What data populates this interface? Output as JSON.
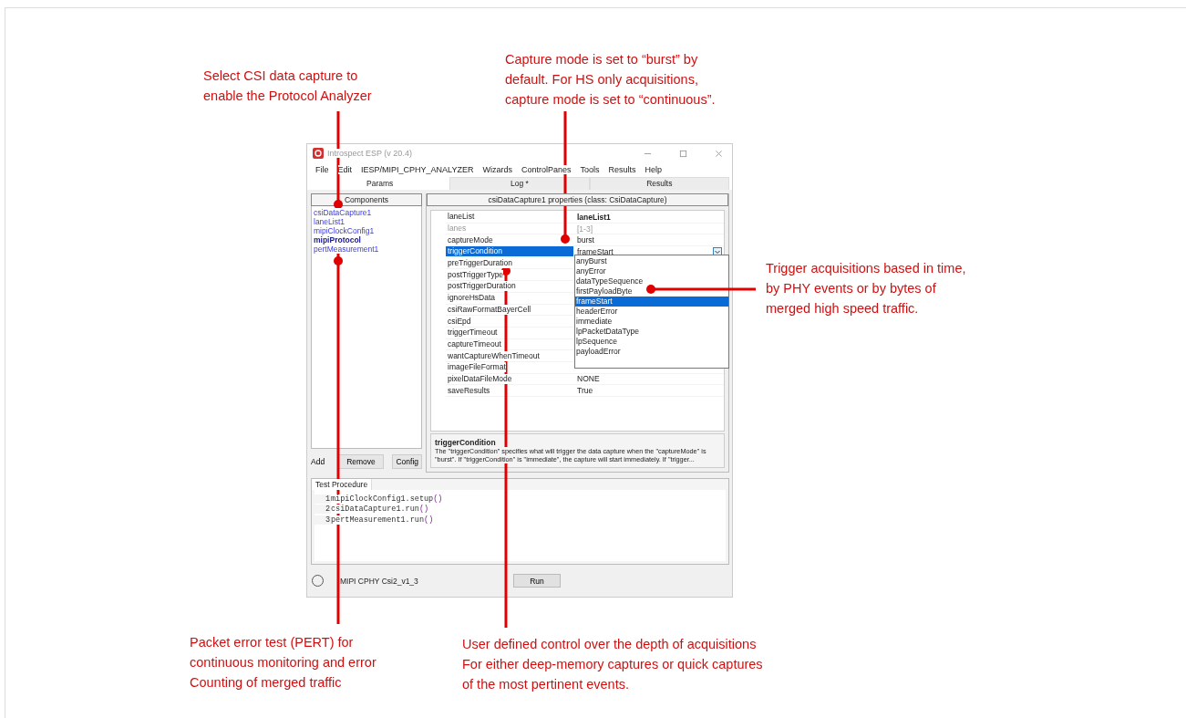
{
  "annotations": [
    {
      "kind": "top-left",
      "lines": [
        "Select CSI data capture to",
        "enable the Protocol Analyzer"
      ]
    },
    {
      "kind": "top-center",
      "lines": [
        "Capture mode is set to “burst” by",
        "default.  For HS only acquisitions,",
        "capture mode is set to “continuous”."
      ]
    },
    {
      "kind": "right",
      "lines": [
        "Trigger acquisitions based in time,",
        "by PHY events or by bytes of",
        "merged high speed traffic."
      ]
    },
    {
      "kind": "bottom-left",
      "lines": [
        "Packet error test (PERT) for",
        "continuous monitoring and error",
        "Counting of merged traffic"
      ]
    },
    {
      "kind": "bottom-center",
      "lines": [
        "User defined control over the depth of acquisitions",
        "For either deep-memory captures or quick captures",
        "of the most pertinent events."
      ]
    }
  ],
  "window": {
    "title": "Introspect ESP (v 20.4)",
    "menu": [
      "File",
      "Edit",
      "IESP/MIPI_CPHY_ANALYZER",
      "Wizards",
      "ControlPanes",
      "Tools",
      "Results",
      "Help"
    ],
    "tabs": [
      {
        "label": "Params",
        "selected": true
      },
      {
        "label": "Log *",
        "selected": false
      },
      {
        "label": "Results",
        "selected": false
      }
    ],
    "components": {
      "header": "Components",
      "items": [
        {
          "label": "csiDataCapture1",
          "bold": false
        },
        {
          "label": "laneList1",
          "bold": false
        },
        {
          "label": "mipiClockConfig1",
          "bold": false
        },
        {
          "label": "mipiProtocol",
          "bold": true
        },
        {
          "label": "pertMeasurement1",
          "bold": false
        }
      ],
      "buttons": [
        "Add",
        "Remove",
        "Config"
      ]
    },
    "properties": {
      "header": "csiDataCapture1 properties (class: CsiDataCapture)",
      "rows": [
        {
          "name": "laneList",
          "value": "laneList1",
          "bold": true,
          "disabled": false,
          "selected": false
        },
        {
          "name": "lanes",
          "value": "[1-3]",
          "bold": false,
          "disabled": true,
          "selected": false
        },
        {
          "name": "captureMode",
          "value": "burst",
          "bold": false,
          "disabled": false,
          "selected": false
        },
        {
          "name": "triggerCondition",
          "value": "frameStart",
          "disabled": false,
          "selected": true
        },
        {
          "name": "preTriggerDuration",
          "disabled": false,
          "selected": false
        },
        {
          "name": "postTriggerType",
          "disabled": false,
          "selected": false
        },
        {
          "name": "postTriggerDuration",
          "disabled": false,
          "selected": false
        },
        {
          "name": "ignoreHsData",
          "disabled": false,
          "selected": false
        },
        {
          "name": "csiRawFormatBayerCell",
          "disabled": false,
          "selected": false
        },
        {
          "name": "csiEpd",
          "disabled": false,
          "selected": false
        },
        {
          "name": "triggerTimeout",
          "disabled": false,
          "selected": false
        },
        {
          "name": "captureTimeout",
          "disabled": false,
          "selected": false
        },
        {
          "name": "wantCaptureWhenTimeout",
          "disabled": false,
          "selected": false
        },
        {
          "name": "imageFileFormat",
          "disabled": false,
          "selected": false
        },
        {
          "name": "pixelDataFileMode",
          "value": "NONE",
          "bold": false,
          "disabled": false,
          "selected": false
        },
        {
          "name": "saveResults",
          "value": "True",
          "bold": false,
          "disabled": false,
          "selected": false
        }
      ],
      "dropdown": [
        {
          "label": "anyBurst",
          "selected": false
        },
        {
          "label": "anyError",
          "selected": false
        },
        {
          "label": "dataTypeSequence",
          "selected": false
        },
        {
          "label": "firstPayloadByte",
          "selected": false
        },
        {
          "label": "frameStart",
          "selected": true
        },
        {
          "label": "headerError",
          "selected": false
        },
        {
          "label": "immediate",
          "selected": false
        },
        {
          "label": "lpPacketDataType",
          "selected": false
        },
        {
          "label": "lpSequence",
          "selected": false
        },
        {
          "label": "payloadError",
          "selected": false
        }
      ],
      "description": {
        "title": "triggerCondition",
        "text": "The \"triggerCondition\" specifies what will trigger the data capture when the \"captureMode\" is \"burst\". If \"triggerCondition\" is \"immediate\", the capture will start immediately. If \"trigger..."
      }
    },
    "test_procedure": {
      "tab": "Test Procedure",
      "lines": [
        {
          "number": "1",
          "code": "mipiClockConfig1.setup",
          "parens": "()"
        },
        {
          "number": "2",
          "code": "csiDataCapture1.run",
          "parens": "()"
        },
        {
          "number": "3",
          "code": "pertMeasurement1.run",
          "parens": "()"
        }
      ]
    },
    "status": {
      "checked": false,
      "label": "MIPI CPHY Csi2_v1_3",
      "button": "Run"
    }
  }
}
